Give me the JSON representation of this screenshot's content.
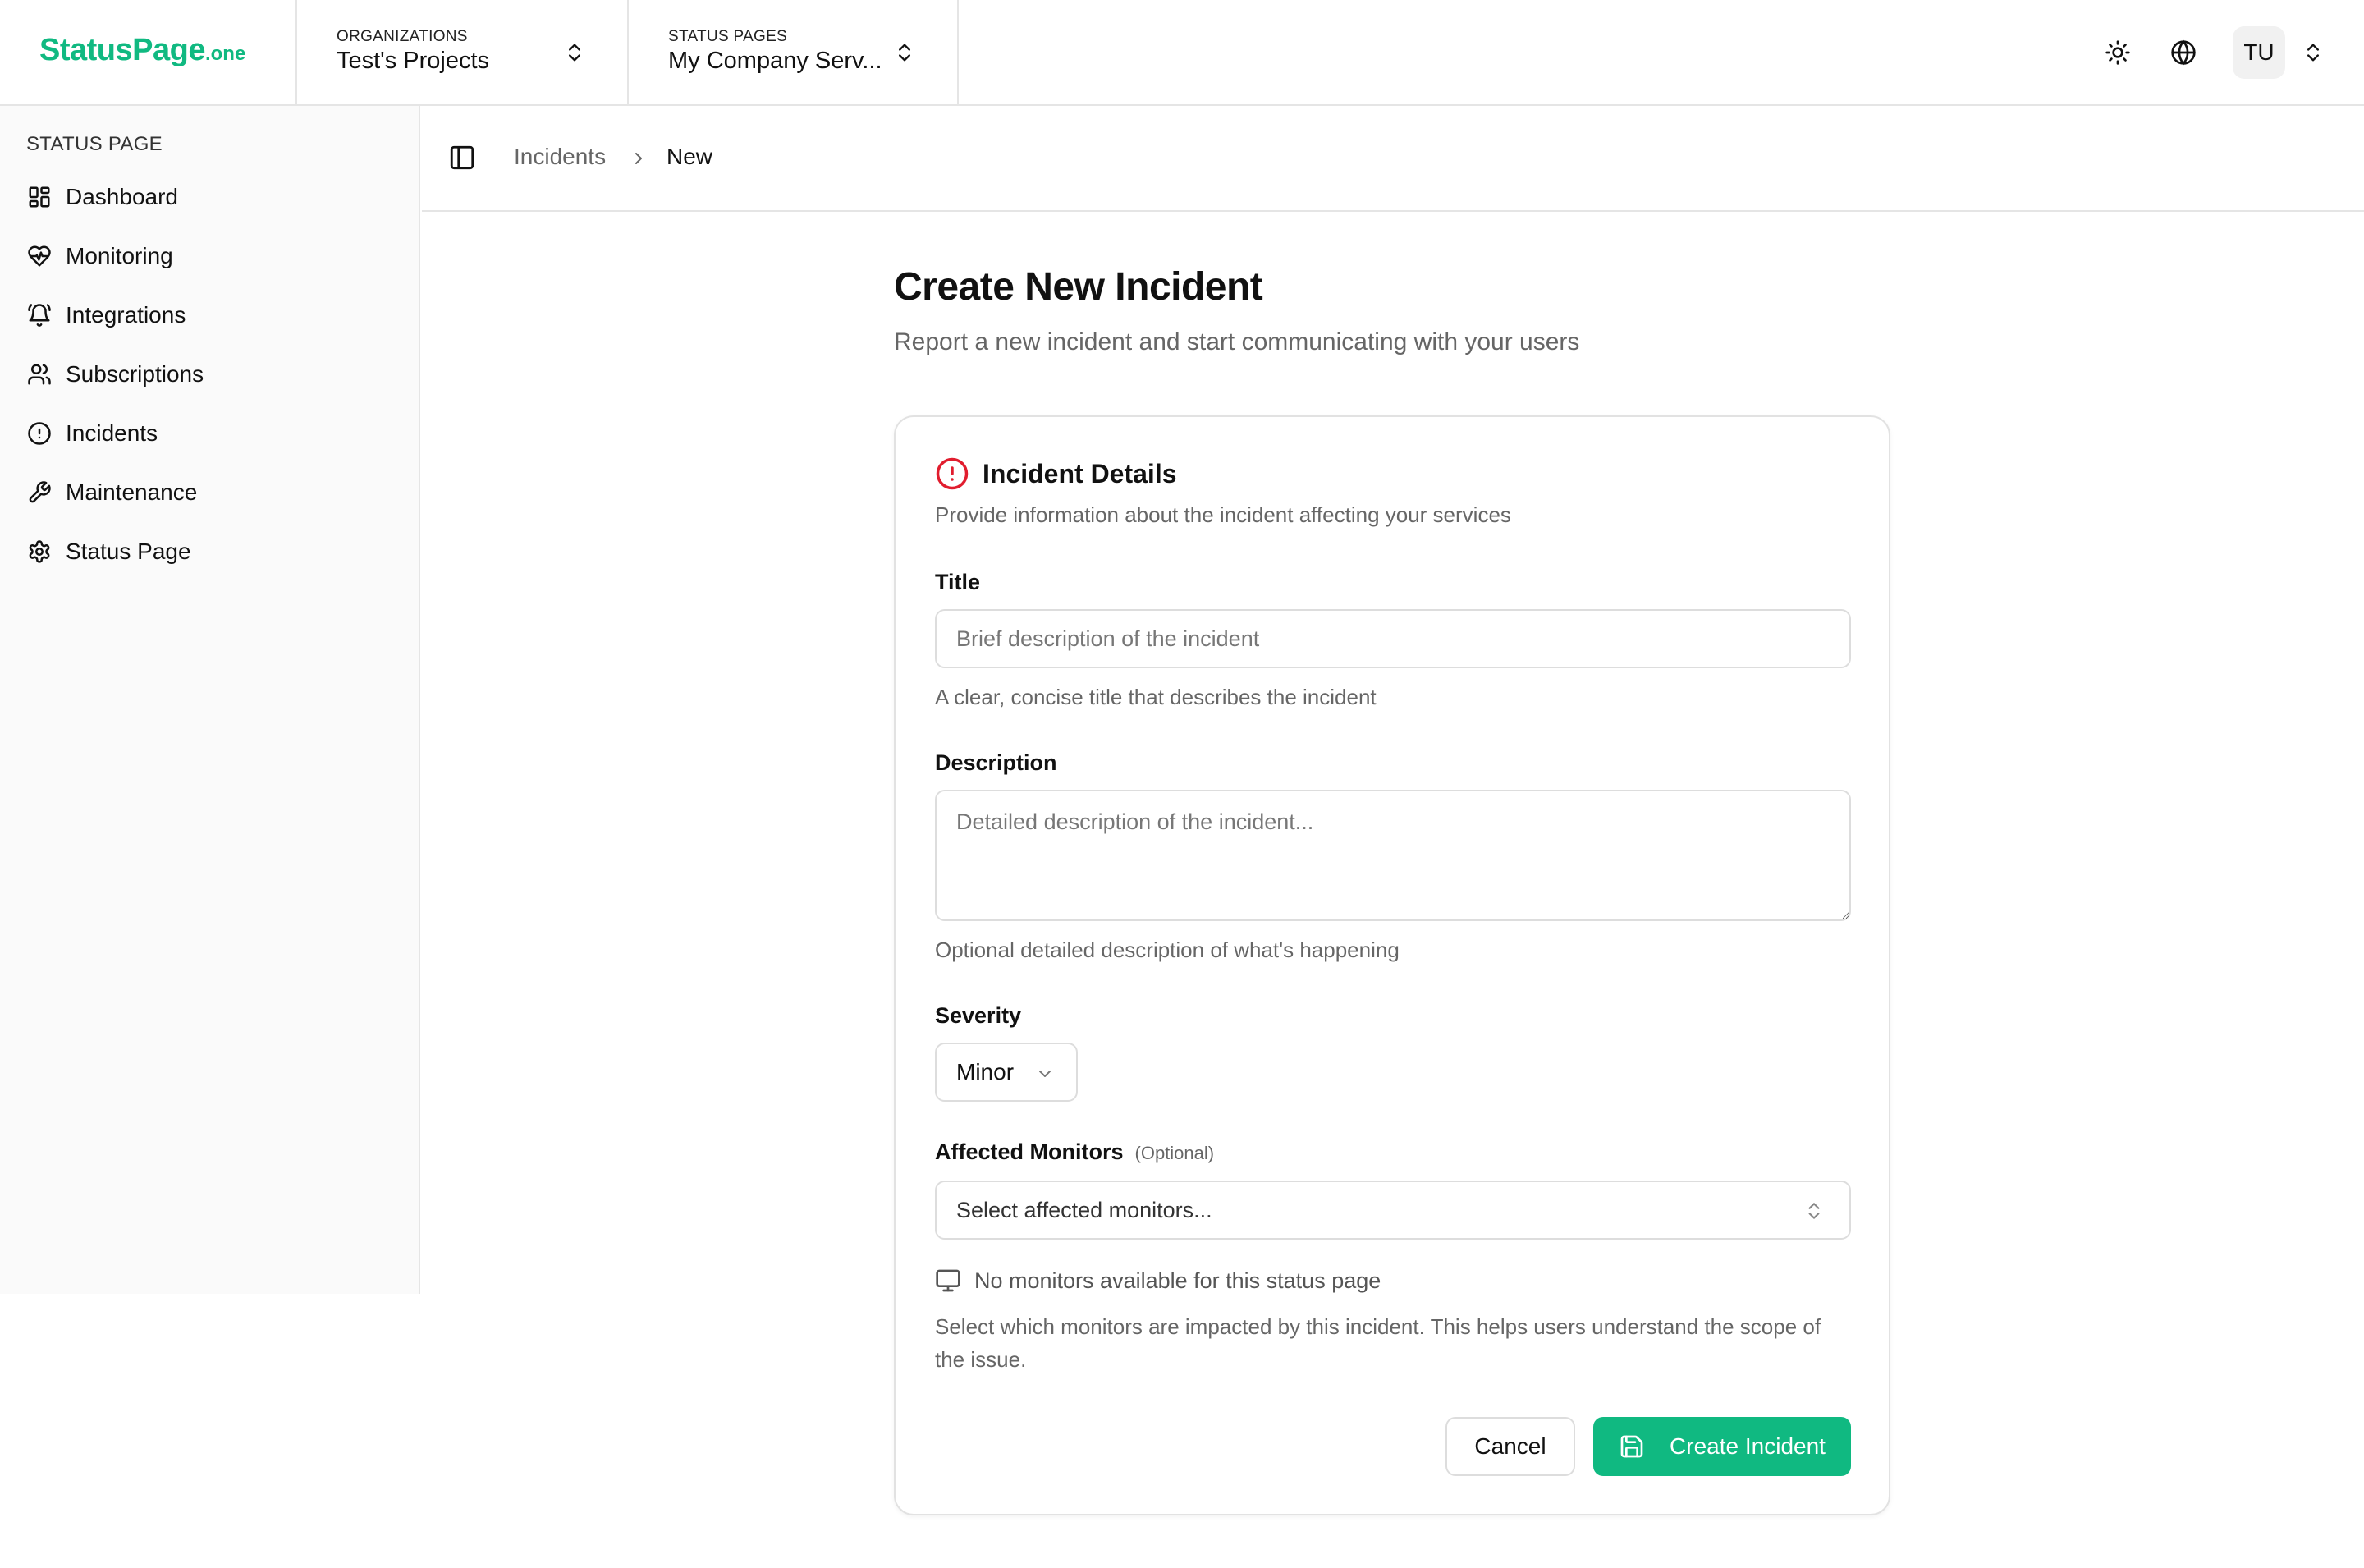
{
  "header": {
    "logo_main": "StatusPage",
    "logo_suffix": ".one",
    "organizations": {
      "caption": "ORGANIZATIONS",
      "value": "Test's Projects"
    },
    "status_pages": {
      "caption": "STATUS PAGES",
      "value": "My Company Serv..."
    },
    "user_initials": "TU"
  },
  "sidebar": {
    "heading": "STATUS PAGE",
    "items": [
      {
        "label": "Dashboard",
        "icon": "dashboard-icon"
      },
      {
        "label": "Monitoring",
        "icon": "heart-pulse-icon"
      },
      {
        "label": "Integrations",
        "icon": "bell-icon"
      },
      {
        "label": "Subscriptions",
        "icon": "users-icon"
      },
      {
        "label": "Incidents",
        "icon": "alert-circle-icon"
      },
      {
        "label": "Maintenance",
        "icon": "wrench-icon"
      },
      {
        "label": "Status Page",
        "icon": "gear-icon"
      }
    ]
  },
  "breadcrumb": {
    "parent": "Incidents",
    "current": "New"
  },
  "page": {
    "title": "Create New Incident",
    "subtitle": "Report a new incident and start communicating with your users"
  },
  "card": {
    "title": "Incident Details",
    "description": "Provide information about the incident affecting your services",
    "title_field": {
      "label": "Title",
      "placeholder": "Brief description of the incident",
      "value": "",
      "hint": "A clear, concise title that describes the incident"
    },
    "description_field": {
      "label": "Description",
      "placeholder": "Detailed description of the incident...",
      "value": "",
      "hint": "Optional detailed description of what's happening"
    },
    "severity": {
      "label": "Severity",
      "value": "Minor"
    },
    "monitors": {
      "label": "Affected Monitors",
      "optional": "(Optional)",
      "placeholder": "Select affected monitors...",
      "empty": "No monitors available for this status page",
      "help": "Select which monitors are impacted by this incident. This helps users understand the scope of the issue."
    },
    "buttons": {
      "cancel": "Cancel",
      "create": "Create Incident"
    }
  },
  "colors": {
    "brand": "#10b981",
    "alert": "#e11d2e",
    "border": "#e5e5e5"
  }
}
